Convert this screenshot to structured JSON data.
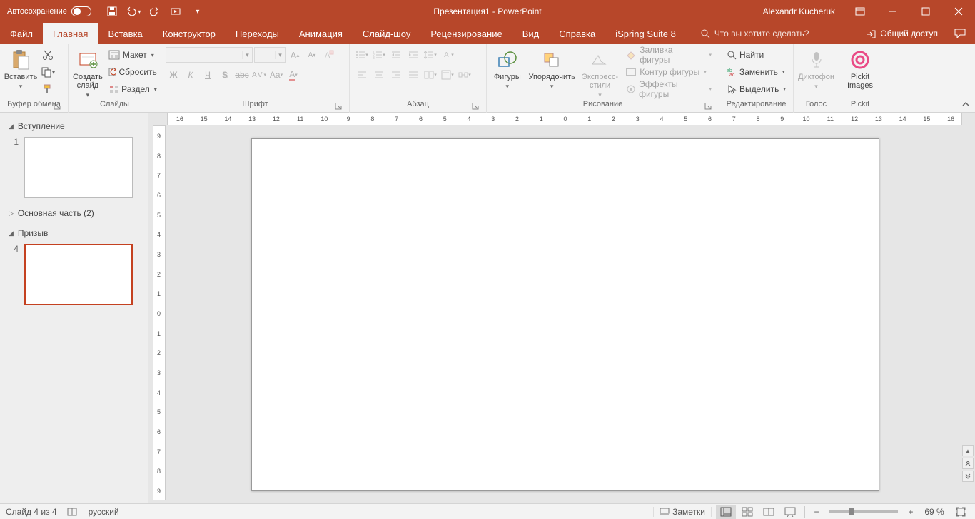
{
  "titlebar": {
    "autosave": "Автосохранение",
    "title": "Презентация1  -  PowerPoint",
    "user": "Alexandr Kucheruk"
  },
  "tabs": {
    "file": "Файл",
    "home": "Главная",
    "insert": "Вставка",
    "design": "Конструктор",
    "transitions": "Переходы",
    "animations": "Анимация",
    "slideshow": "Слайд-шоу",
    "review": "Рецензирование",
    "view": "Вид",
    "help": "Справка",
    "ispring": "iSpring Suite 8",
    "tellme": "Что вы хотите сделать?",
    "share": "Общий доступ"
  },
  "ribbon": {
    "clipboard": {
      "label": "Буфер обмена",
      "paste": "Вставить"
    },
    "slides": {
      "label": "Слайды",
      "new": "Создать\nслайд",
      "layout": "Макет",
      "reset": "Сбросить",
      "section": "Раздел"
    },
    "font": {
      "label": "Шрифт"
    },
    "paragraph": {
      "label": "Абзац"
    },
    "drawing": {
      "label": "Рисование",
      "shapes": "Фигуры",
      "arrange": "Упорядочить",
      "quickstyles": "Экспресс-\nстили",
      "fill": "Заливка фигуры",
      "outline": "Контур фигуры",
      "effects": "Эффекты фигуры"
    },
    "editing": {
      "label": "Редактирование",
      "find": "Найти",
      "replace": "Заменить",
      "select": "Выделить"
    },
    "voice": {
      "label": "Голос",
      "dictate": "Диктофон"
    },
    "pickit": {
      "label": "Pickit",
      "btn": "Pickit\nImages"
    }
  },
  "outline": {
    "sec1": "Вступление",
    "sec2": "Основная часть (2)",
    "sec3": "Призыв",
    "n1": "1",
    "n4": "4"
  },
  "ruler": {
    "h": [
      "16",
      "15",
      "14",
      "13",
      "12",
      "11",
      "10",
      "9",
      "8",
      "7",
      "6",
      "5",
      "4",
      "3",
      "2",
      "1",
      "0",
      "1",
      "2",
      "3",
      "4",
      "5",
      "6",
      "7",
      "8",
      "9",
      "10",
      "11",
      "12",
      "13",
      "14",
      "15",
      "16"
    ],
    "v": [
      "9",
      "8",
      "7",
      "6",
      "5",
      "4",
      "3",
      "2",
      "1",
      "0",
      "1",
      "2",
      "3",
      "4",
      "5",
      "6",
      "7",
      "8",
      "9"
    ]
  },
  "status": {
    "slide": "Слайд 4 из 4",
    "lang": "русский",
    "notes": "Заметки",
    "zoom": "69 %"
  }
}
